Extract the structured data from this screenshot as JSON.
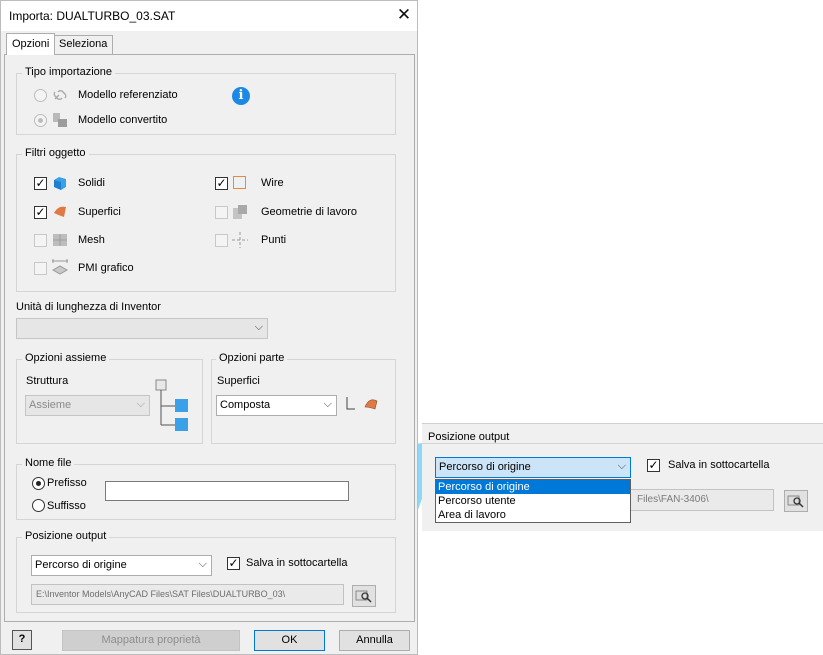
{
  "window": {
    "title": "Importa: DUALTURBO_03.SAT",
    "close": "✕"
  },
  "tabs": [
    "Opzioni",
    "Seleziona"
  ],
  "tipo": {
    "legend": "Tipo importazione",
    "options": [
      "Modello referenziato",
      "Modello convertito"
    ],
    "selected_index": 1,
    "info_glyph": "i"
  },
  "filtri": {
    "legend": "Filtri oggetto",
    "items": [
      {
        "label": "Solidi",
        "checked": true,
        "enabled": true,
        "icon": "solid-cube-icon"
      },
      {
        "label": "Wire",
        "checked": true,
        "enabled": true,
        "icon": "wire-square-icon"
      },
      {
        "label": "Superfici",
        "checked": true,
        "enabled": true,
        "icon": "surface-icon"
      },
      {
        "label": "Geometrie di lavoro",
        "checked": false,
        "enabled": false,
        "icon": "work-geometry-icon"
      },
      {
        "label": "Mesh",
        "checked": false,
        "enabled": false,
        "icon": "mesh-icon"
      },
      {
        "label": "Punti",
        "checked": false,
        "enabled": false,
        "icon": "point-icon"
      },
      {
        "label": "PMI grafico",
        "checked": false,
        "enabled": false,
        "icon": "pmi-icon"
      }
    ]
  },
  "unita": {
    "label": "Unità di lunghezza di Inventor",
    "value": ""
  },
  "assieme": {
    "legend": "Opzioni assieme",
    "struttura_label": "Struttura",
    "struttura_value": "Assieme"
  },
  "parte": {
    "legend": "Opzioni parte",
    "superfici_label": "Superfici",
    "superfici_value": "Composta"
  },
  "nomefile": {
    "legend": "Nome file",
    "options": [
      "Prefisso",
      "Suffisso"
    ],
    "selected_index": 0,
    "value": ""
  },
  "posizione": {
    "legend": "Posizione output",
    "combo_value": "Percorso di origine",
    "salva_label": "Salva in sottocartella",
    "salva_checked": true,
    "path": "E:\\Inventor Models\\AnyCAD Files\\SAT Files\\DUALTURBO_03\\"
  },
  "footer": {
    "help": "?",
    "mappatura": "Mappatura proprietà",
    "ok": "OK",
    "annulla": "Annulla"
  },
  "zoom": {
    "legend": "Posizione output",
    "combo_value": "Percorso di origine",
    "salva_label": "Salva in sottocartella",
    "path_fragment": "Files\\FAN-3406\\",
    "dropdown": [
      "Percorso di origine",
      "Percorso utente",
      "Area di lavoro"
    ],
    "dropdown_selected": 0
  },
  "colors": {
    "accent": "#0078d7",
    "highlight": "#7fd4f5",
    "info": "#1e88e5"
  }
}
